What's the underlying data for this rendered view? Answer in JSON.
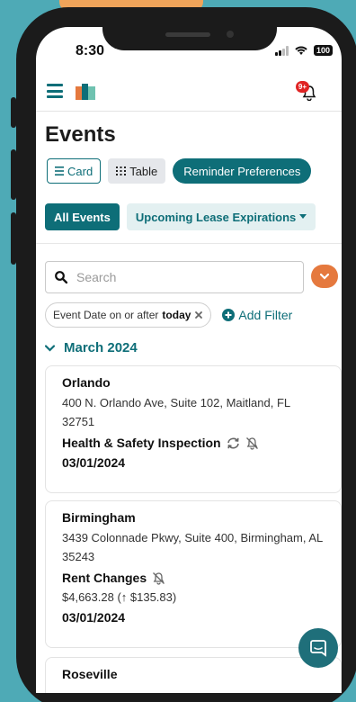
{
  "status": {
    "time": "8:30",
    "battery": "100"
  },
  "header": {
    "badge": "9+"
  },
  "page": {
    "title": "Events"
  },
  "views": {
    "card": "Card",
    "table": "Table",
    "preferences": "Reminder Preferences"
  },
  "filters": {
    "all": "All Events",
    "upcoming": "Upcoming Lease Expirations"
  },
  "search": {
    "placeholder": "Search"
  },
  "chip": {
    "prefix": "Event Date on or after",
    "value": "today"
  },
  "add_filter": "Add Filter",
  "month": "March 2024",
  "events": [
    {
      "name": "Orlando",
      "address": "400 N. Orlando Ave, Suite 102, Maitland, FL 32751",
      "type": "Health & Safety Inspection",
      "date": "03/01/2024"
    },
    {
      "name": "Birmingham",
      "address": "3439 Colonnade Pkwy, Suite 400, Birmingham, AL 35243",
      "type": "Rent Changes",
      "amount": "$4,663.28 (↑ $135.83)",
      "date": "03/01/2024"
    },
    {
      "name": "Roseville"
    }
  ],
  "colors": {
    "teal": "#0e6e78",
    "orange": "#e5793e",
    "background": "#4eaab6"
  }
}
